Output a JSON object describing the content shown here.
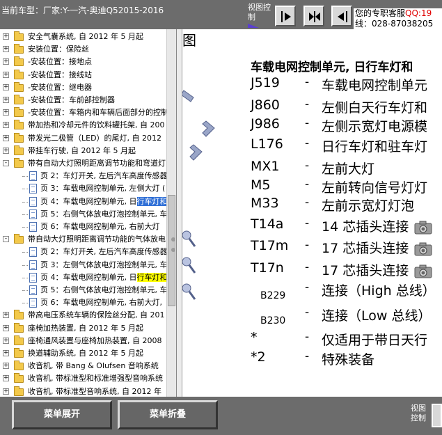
{
  "topbar": {
    "car_model": "当前车型：厂家:Y-一汽-奥迪Q52015-2016",
    "view_control_label": "视图控制",
    "service_line1": "您的专职客服",
    "service_qq": "QQ:19",
    "service_line2": "线：028-87038205"
  },
  "tree": [
    {
      "level": 0,
      "expander": "+",
      "icon": "folder",
      "label": "安全气囊系统, 自 2012 年 5 月起"
    },
    {
      "level": 0,
      "expander": "+",
      "icon": "folder",
      "label": "安装位置：保险丝"
    },
    {
      "level": 0,
      "expander": "+",
      "icon": "folder",
      "label": "-安装位置：接地点"
    },
    {
      "level": 0,
      "expander": "+",
      "icon": "folder",
      "label": "-安装位置：接线站"
    },
    {
      "level": 0,
      "expander": "+",
      "icon": "folder",
      "label": "-安装位置：继电器"
    },
    {
      "level": 0,
      "expander": "+",
      "icon": "folder",
      "label": "-安装位置：车前部控制器"
    },
    {
      "level": 0,
      "expander": "+",
      "icon": "folder",
      "label": "-安装位置：车箱内和车辆后面部分的控制"
    },
    {
      "level": 0,
      "expander": "+",
      "icon": "folder",
      "label": "带加热和冷却元件的饮料罐托架, 自 200"
    },
    {
      "level": 0,
      "expander": "+",
      "icon": "folder",
      "label": "带发光二极管（LED）的尾灯, 自 2012"
    },
    {
      "level": 0,
      "expander": "+",
      "icon": "folder",
      "label": "带挂车行驶, 自 2012 年 5 月起"
    },
    {
      "level": 0,
      "expander": "-",
      "icon": "folder",
      "label": "带有自动大灯照明距离调节功能和弯道灯"
    },
    {
      "level": 1,
      "expander": "",
      "icon": "page",
      "label": "页 2：车灯开关, 左后汽车高度传感器"
    },
    {
      "level": 1,
      "expander": "",
      "icon": "page",
      "label": "页 3：车载电网控制单元, 左侧大灯 ("
    },
    {
      "level": 1,
      "expander": "",
      "icon": "page",
      "label": "页 4：车载电网控制单元, 日",
      "highlight": "行车灯和",
      "highlight_color": "blue"
    },
    {
      "level": 1,
      "expander": "",
      "icon": "page",
      "label": "页 5：右侧气体放电灯泡控制单元, 车"
    },
    {
      "level": 1,
      "expander": "",
      "icon": "page",
      "label": "页 6：车载电网控制单元, 右前大灯"
    },
    {
      "level": 0,
      "expander": "-",
      "icon": "folder",
      "label": "带自动大灯照明距离调节功能的气体放电"
    },
    {
      "level": 1,
      "expander": "",
      "icon": "page",
      "label": "页 2：车灯开关, 左后汽车高度传感器"
    },
    {
      "level": 1,
      "expander": "",
      "icon": "page",
      "label": "页 3：左侧气体放电灯泡控制单元, 车"
    },
    {
      "level": 1,
      "expander": "",
      "icon": "page",
      "label": "页 4：车载电网控制单元, 日",
      "highlight": "行车灯和",
      "highlight_color": "yellow"
    },
    {
      "level": 1,
      "expander": "",
      "icon": "page",
      "label": "页 5：右侧气体放电灯泡控制单元, 车"
    },
    {
      "level": 1,
      "expander": "",
      "icon": "page",
      "label": "页 6：车载电网控制单元, 右前大灯,"
    },
    {
      "level": 0,
      "expander": "+",
      "icon": "folder",
      "label": "带高电压系统车辆的保险丝分配, 自 201"
    },
    {
      "level": 0,
      "expander": "+",
      "icon": "folder",
      "label": "座椅加热装置, 自 2012 年 5 月起"
    },
    {
      "level": 0,
      "expander": "+",
      "icon": "folder",
      "label": "座椅通风装置与座椅加热装置, 自 2008"
    },
    {
      "level": 0,
      "expander": "+",
      "icon": "folder",
      "label": "换道辅助系统, 自 2012 年 5 月起"
    },
    {
      "level": 0,
      "expander": "+",
      "icon": "folder",
      "label": "收音机, 带 Bang & Olufsen 音响系统"
    },
    {
      "level": 0,
      "expander": "+",
      "icon": "folder",
      "label": "收音机, 带标准型和标准增强型音响系统"
    },
    {
      "level": 0,
      "expander": "+",
      "icon": "folder",
      "label": "收音机, 带标准型音响系统, 自 2012 年"
    }
  ],
  "document": {
    "corner_text": "图",
    "heading": "车载电网控制单元, 日行车灯和",
    "legend": [
      {
        "code": "J519",
        "desc": "车载电网控制单元",
        "small": false
      },
      {
        "code": "J860",
        "desc": "左侧白天行车灯和",
        "small": false
      },
      {
        "code": "J986",
        "desc": "左侧示宽灯电源模",
        "small": false
      },
      {
        "code": "L176",
        "desc": "日行车灯和驻车灯",
        "small": false
      },
      {
        "code": "MX1",
        "desc": "左前大灯",
        "small": false
      },
      {
        "code": "M5",
        "desc": "左前转向信号灯灯",
        "small": false
      },
      {
        "code": "M33",
        "desc": "左前示宽灯灯泡",
        "small": false
      },
      {
        "code": "T14a",
        "desc": "14 芯插头连接",
        "small": false,
        "camera": true
      },
      {
        "code": "T17m",
        "desc": "17 芯插头连接",
        "small": false,
        "camera": true
      },
      {
        "code": "T17n",
        "desc": "17 芯插头连接",
        "small": false,
        "camera": true
      },
      {
        "code": "B229",
        "desc": "连接（High 总线）",
        "small": true
      },
      {
        "code": "B230",
        "desc": "连接（Low 总线）",
        "small": true
      },
      {
        "code": "*",
        "desc": "仅适用于带日天行",
        "small": false
      },
      {
        "code": "*2",
        "desc": "特殊装备",
        "small": false
      }
    ],
    "dash": "-"
  },
  "bottombar": {
    "expand_label": "菜单展开",
    "collapse_label": "菜单折叠",
    "view_control_label": "视图控制"
  },
  "colors": {
    "toolbar_bg": "#6c6c6c",
    "selection_blue": "#2f6fd6",
    "highlight_yellow": "#ffff00",
    "qq_red": "#e00000"
  }
}
